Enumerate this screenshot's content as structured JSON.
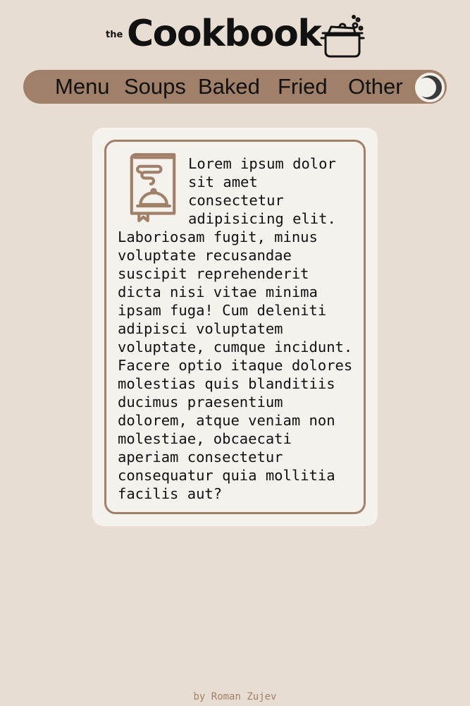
{
  "header": {
    "logo_small": "the",
    "logo_title": "Cookbook"
  },
  "nav": {
    "items": [
      {
        "label": "Menu"
      },
      {
        "label": "Soups"
      },
      {
        "label": "Baked"
      },
      {
        "label": "Fried"
      },
      {
        "label": "Other"
      }
    ],
    "theme_toggle_icon": "moon-icon"
  },
  "card": {
    "icon": "recipe-book-icon",
    "text": "Lorem ipsum dolor sit amet consectetur adipisicing elit. Laboriosam fugit, minus voluptate recusandae suscipit reprehenderit dicta nisi vitae minima ipsam fuga! Cum deleniti adipisci voluptatem voluptate, cumque incidunt. Facere optio itaque dolores molestias quis blanditiis ducimus praesentium dolorem, atque veniam non molestiae, obcaecati aperiam consectetur consequatur quia mollitia facilis aut?"
  },
  "footer": {
    "credit": "by Roman Zujev"
  },
  "colors": {
    "background": "#e8ddd2",
    "accent": "#a08068",
    "card": "#f5f2ee"
  }
}
